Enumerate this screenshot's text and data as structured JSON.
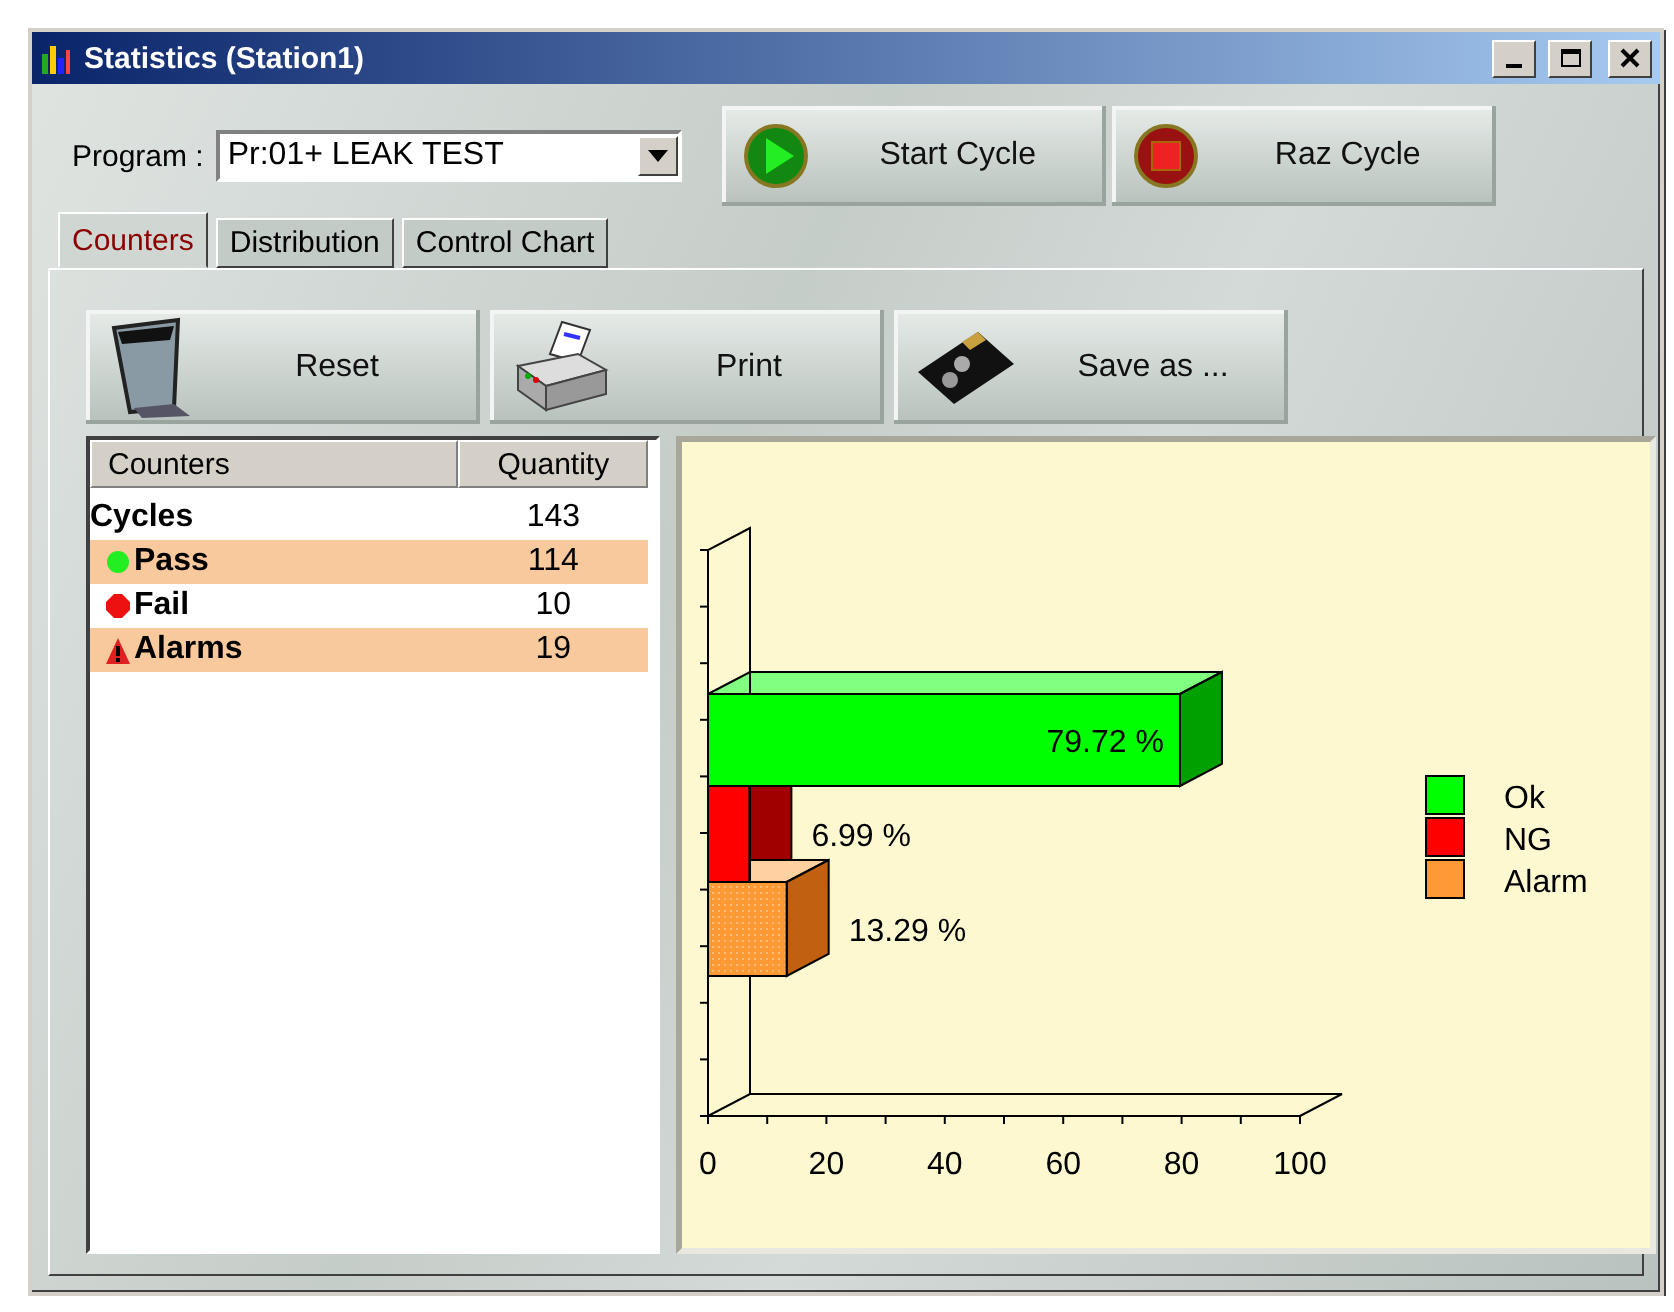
{
  "window": {
    "title": "Statistics (Station1)"
  },
  "program": {
    "label": "Program :",
    "value": "Pr:01+ LEAK TEST"
  },
  "actions": [
    {
      "kind": "play",
      "label": "Start Cycle"
    },
    {
      "kind": "stop",
      "label": "Raz Cycle"
    }
  ],
  "tabs": [
    {
      "label": "Counters",
      "selected": true
    },
    {
      "label": "Distribution",
      "selected": false
    },
    {
      "label": "Control Chart",
      "selected": false
    }
  ],
  "toolbar": [
    {
      "kind": "trash",
      "label": "Reset"
    },
    {
      "kind": "printer",
      "label": "Print"
    },
    {
      "kind": "disk",
      "label": "Save as ..."
    }
  ],
  "table": {
    "columns": [
      "Counters",
      "Quantity"
    ],
    "rows": [
      {
        "kind": "total",
        "name": "Cycles",
        "quantity": "143",
        "highlighted": false
      },
      {
        "kind": "pass",
        "name": "Pass",
        "quantity": "114",
        "highlighted": true
      },
      {
        "kind": "fail",
        "name": "Fail",
        "quantity": "10",
        "highlighted": false
      },
      {
        "kind": "alarm",
        "name": "Alarms",
        "quantity": "19",
        "highlighted": true
      }
    ]
  },
  "chart": {
    "chart_data": {
      "type": "bar",
      "orientation": "horizontal",
      "xlim": [
        0,
        100
      ],
      "xticks": [
        0,
        20,
        40,
        60,
        80,
        100
      ],
      "series": [
        {
          "name": "Ok",
          "color": "#00ff00",
          "values": [
            79.72
          ]
        },
        {
          "name": "NG",
          "color": "#ff0000",
          "values": [
            6.99
          ]
        },
        {
          "name": "Alarm",
          "color": "#ff9933",
          "values": [
            13.29
          ]
        }
      ],
      "value_labels": [
        "79.72 %",
        "6.99 %",
        "13.29 %"
      ],
      "legend": "right"
    }
  }
}
